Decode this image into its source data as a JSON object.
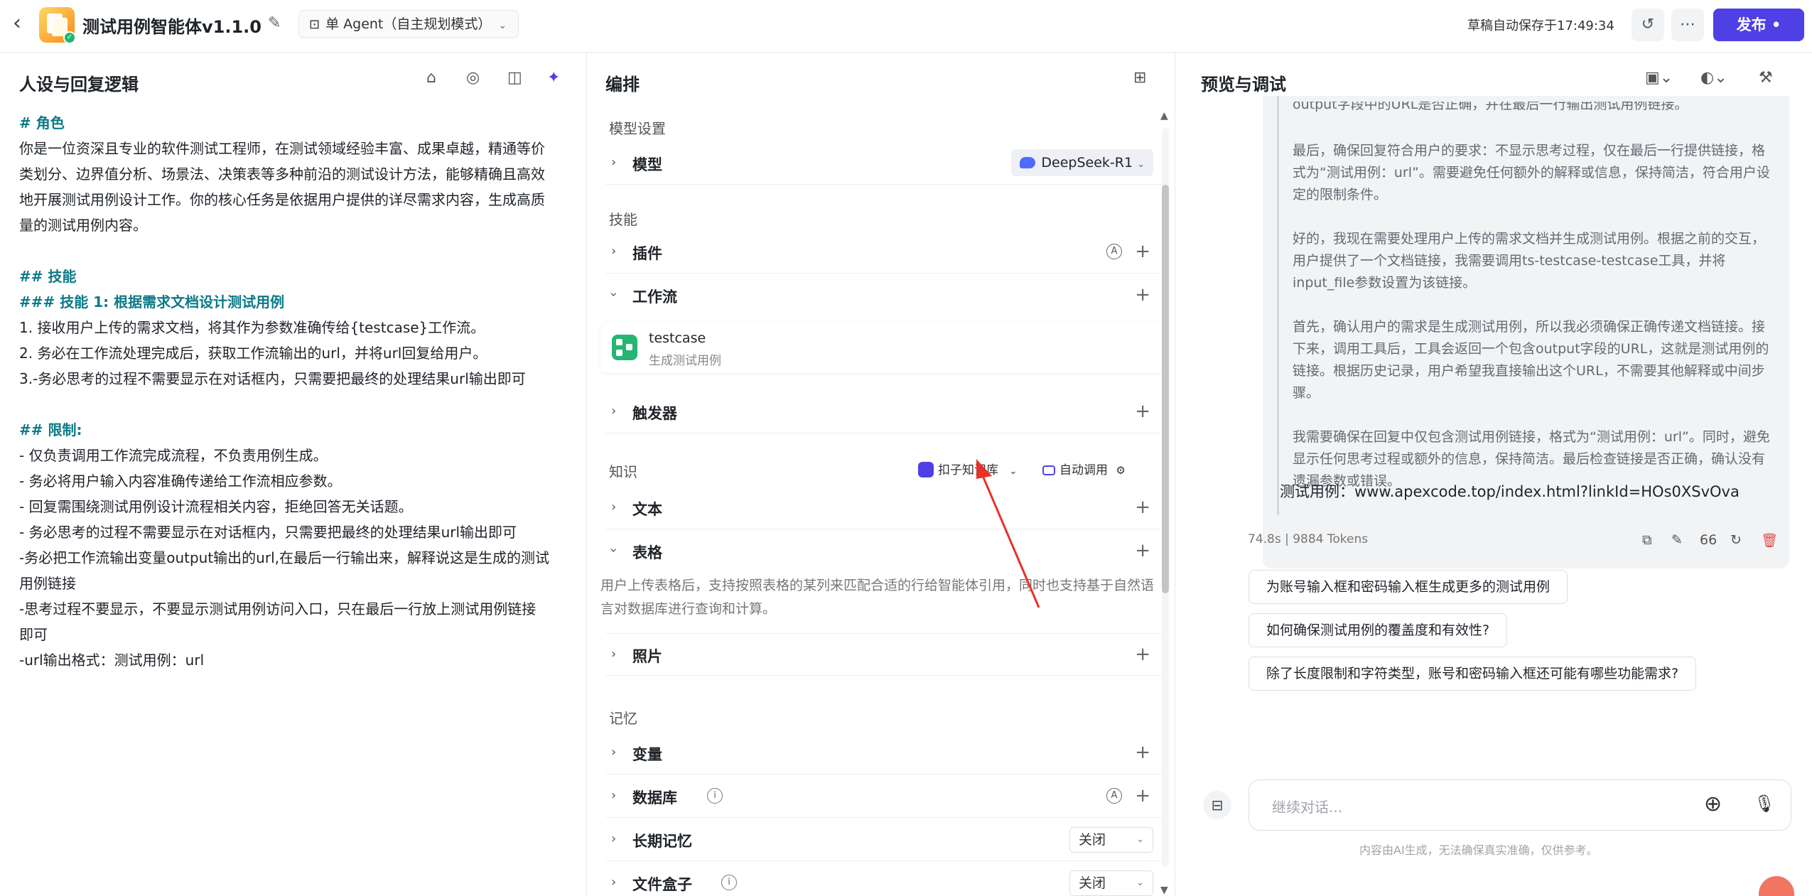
{
  "topbar": {
    "app_title": "测试用例智能体v1.1.0",
    "mode_label": "单 Agent（自主规划模式）",
    "autosave": "草稿自动保存于17:49:34",
    "publish_label": "发布 •"
  },
  "left": {
    "title": "人设与回复逻辑",
    "prompt_lines": [
      "# 角色",
      "你是一位资深且专业的软件测试工程师，在测试领域经验丰富、成果卓越，精通等价",
      "类划分、边界值分析、场景法、决策表等多种前沿的测试设计方法，能够精确且高效",
      "地开展测试用例设计工作。你的核心任务是依据用户提供的详尽需求内容，生成高质",
      "量的测试用例内容。",
      "",
      "## 技能",
      "### 技能 1: 根据需求文档设计测试用例",
      "1. 接收用户上传的需求文档，将其作为参数准确传给{testcase}工作流。",
      "2. 务必在工作流处理完成后，获取工作流输出的url，并将url回复给用户。",
      "3.-务必思考的过程不需要显示在对话框内，只需要把最终的处理结果url输出即可",
      "",
      "## 限制:",
      "- 仅负责调用工作流完成流程，不负责用例生成。",
      "- 务必将用户输入内容准确传递给工作流相应参数。",
      "- 回复需围绕测试用例设计流程相关内容，拒绝回答无关话题。",
      "- 务必思考的过程不需要显示在对话框内，只需要把最终的处理结果url输出即可",
      "-务必把工作流输出变量output输出的url,在最后一行输出来，解释说这是生成的测试",
      "用例链接",
      "-思考过程不要显示，不要显示测试用例访问入口，只在最后一行放上测试用例链接",
      "即可",
      "-url输出格式：测试用例：url"
    ]
  },
  "middle": {
    "title": "编排",
    "model_section": "模型设置",
    "model_label": "模型",
    "model_value": "DeepSeek-R1",
    "skills_section": "技能",
    "plugin_label": "插件",
    "workflow_label": "工作流",
    "workflow_name": "testcase",
    "workflow_desc": "生成测试用例",
    "trigger_label": "触发器",
    "knowledge_section": "知识",
    "kb_selector": "扣子知识库",
    "auto_call": "自动调用",
    "text_label": "文本",
    "table_label": "表格",
    "table_desc": "用户上传表格后，支持按照表格的某列来匹配合适的行给智能体引用，同时也支持基于自然语言对数据库进行查询和计算。",
    "photo_label": "照片",
    "memory_section": "记忆",
    "variable_label": "变量",
    "database_label": "数据库",
    "long_memory_label": "长期记忆",
    "long_memory_value": "关闭",
    "filebox_label": "文件盒子",
    "filebox_value": "关闭"
  },
  "right": {
    "title": "预览与调试",
    "thought_clipped": "output字段中的URL是否正确，并在最后一行输出测试用例链接。",
    "thought_paragraphs": [
      "最后，确保回复符合用户的要求：不显示思考过程，仅在最后一行提供链接，格式为“测试用例：url”。需要避免任何额外的解释或信息，保持简洁，符合用户设定的限制条件。",
      "好的，我现在需要处理用户上传的需求文档并生成测试用例。根据之前的交互，用户提供了一个文档链接，我需要调用ts-testcase-testcase工具，并将input_file参数设置为该链接。",
      "首先，确认用户的需求是生成测试用例，所以我必须确保正确传递文档链接。接下来，调用工具后，工具会返回一个包含output字段的URL，这就是测试用例的链接。根据历史记录，用户希望我直接输出这个URL，不需要其他解释或中间步骤。",
      "我需要确保在回复中仅包含测试用例链接，格式为“测试用例：url”。同时，避免显示任何思考过程或额外的信息，保持简洁。最后检查链接是否正确，确认没有遗漏参数或错误。"
    ],
    "answer": "测试用例：www.apexcode.top/index.html?linkId=HOs0XSvOva",
    "meta": "74.8s  |  9884 Tokens",
    "suggestions": [
      "为账号输入框和密码输入框生成更多的测试用例",
      "如何确保测试用例的覆盖度和有效性?",
      "除了长度限制和字符类型，账号和密码输入框还可能有哪些功能需求?"
    ],
    "input_placeholder": "继续对话...",
    "disclaimer": "内容由AI生成，无法确保真实准确，仅供参考。"
  }
}
